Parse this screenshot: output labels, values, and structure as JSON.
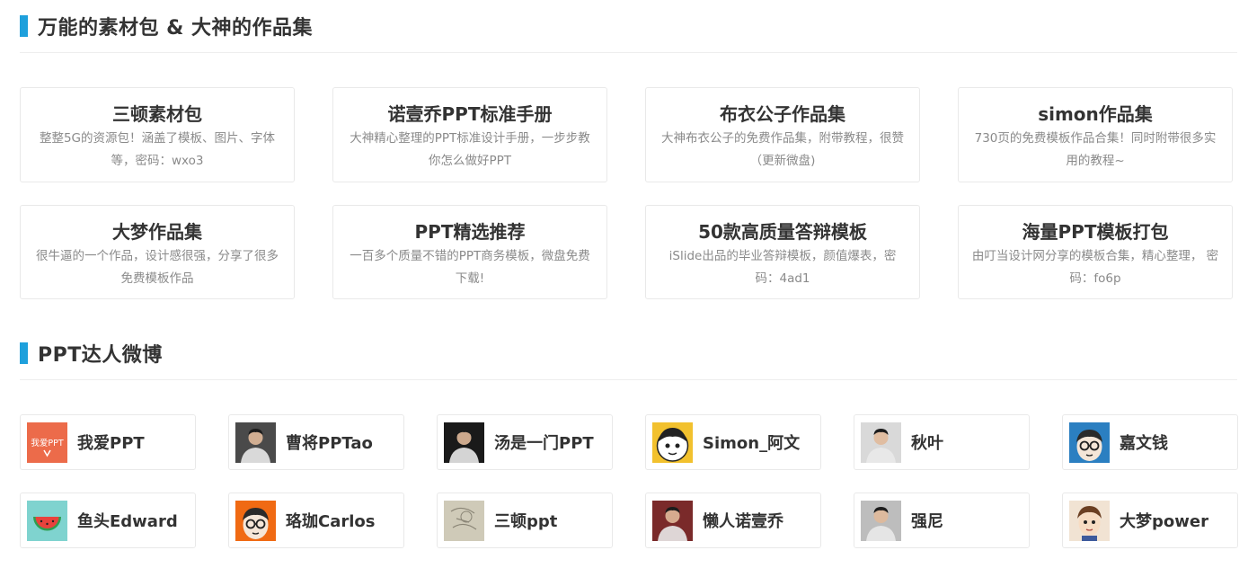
{
  "sections": {
    "resources_title": "万能的素材包 & 大神的作品集",
    "weibo_title": "PPT达人微博"
  },
  "resources": [
    {
      "title": "三顿素材包",
      "desc": "整整5G的资源包！涵盖了模板、图片、字体等，密码：wxo3"
    },
    {
      "title": "诺壹乔PPT标准手册",
      "desc": "大神精心整理的PPT标准设计手册，一步步教你怎么做好PPT"
    },
    {
      "title": "布衣公子作品集",
      "desc": "大神布衣公子的免费作品集，附带教程，很赞（更新微盘)"
    },
    {
      "title": "simon作品集",
      "desc": "730页的免费模板作品合集！同时附带很多实用的教程~"
    },
    {
      "title": "大梦作品集",
      "desc": "很牛逼的一个作品，设计感很强，分享了很多免费模板作品"
    },
    {
      "title": "PPT精选推荐",
      "desc": "一百多个质量不错的PPT商务模板，微盘免费下载!"
    },
    {
      "title": "50款高质量答辩模板",
      "desc": "iSlide出品的毕业答辩模板，颜值爆表，密码：4ad1"
    },
    {
      "title": "海量PPT模板打包",
      "desc": "由叮当设计网分享的模板合集，精心整理， 密码：fo6p"
    }
  ],
  "people": [
    {
      "name": "我爱PPT",
      "avatar_icon": "woai-ppt-logo-icon",
      "avatar_text": "我爱PPT",
      "color": "#ec6b4a"
    },
    {
      "name": "曹将PPTao",
      "avatar_icon": "person-photo-icon",
      "color": "#4a4a4a"
    },
    {
      "name": "汤是一门PPT",
      "avatar_icon": "person-photo-icon",
      "color": "#1a1a1a"
    },
    {
      "name": "Simon_阿文",
      "avatar_icon": "cartoon-face-icon",
      "color": "#f2c12e"
    },
    {
      "name": "秋叶",
      "avatar_icon": "person-photo-icon",
      "color": "#d9d9d9"
    },
    {
      "name": "嘉文钱",
      "avatar_icon": "cartoon-glasses-icon",
      "color": "#2b7fc1"
    },
    {
      "name": "鱼头Edward",
      "avatar_icon": "watermelon-icon",
      "color": "#7fd3cf"
    },
    {
      "name": "珞珈Carlos",
      "avatar_icon": "cartoon-glasses-icon",
      "color": "#f06a13"
    },
    {
      "name": "三顿ppt",
      "avatar_icon": "sketch-icon",
      "color": "#cfcab8"
    },
    {
      "name": "懒人诺壹乔",
      "avatar_icon": "person-photo-icon",
      "color": "#7a2a2a"
    },
    {
      "name": "强尼",
      "avatar_icon": "person-photo-icon",
      "color": "#bdbdbd"
    },
    {
      "name": "大梦power",
      "avatar_icon": "cartoon-boy-icon",
      "color": "#f1e3d3"
    }
  ]
}
